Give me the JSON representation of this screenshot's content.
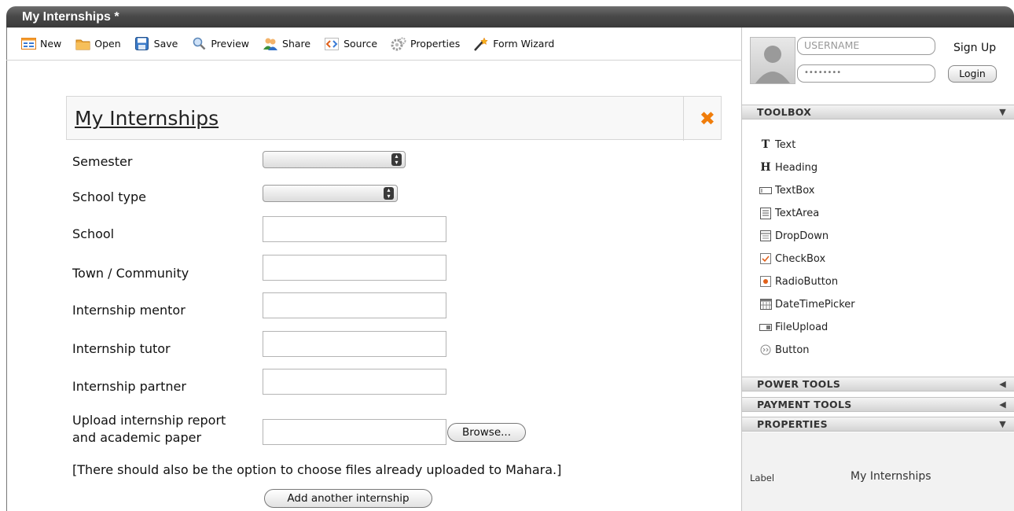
{
  "window": {
    "title": "My Internships *"
  },
  "toolbar": {
    "new": "New",
    "open": "Open",
    "save": "Save",
    "preview": "Preview",
    "share": "Share",
    "source": "Source",
    "properties": "Properties",
    "wizard": "Form Wizard"
  },
  "form": {
    "title": "My Internships",
    "fields": {
      "semester": "Semester",
      "school_type": "School type",
      "school": "School",
      "town": "Town / Community",
      "mentor": "Internship mentor",
      "tutor": "Internship tutor",
      "partner": "Internship partner",
      "upload_1": "Upload internship report",
      "upload_2": "and academic paper"
    },
    "browse": "Browse...",
    "note": "[There should also be the option to choose files already uploaded to Mahara.]",
    "add_button": "Add another internship"
  },
  "login": {
    "username_placeholder": "USERNAME",
    "password_mask": "••••••••",
    "signup": "Sign Up",
    "login": "Login"
  },
  "panels": {
    "toolbox": "TOOLBOX",
    "power": "POWER TOOLS",
    "payment": "PAYMENT TOOLS",
    "properties": "PROPERTIES"
  },
  "toolbox": {
    "items": [
      "Text",
      "Heading",
      "TextBox",
      "TextArea",
      "DropDown",
      "CheckBox",
      "RadioButton",
      "DateTimePicker",
      "FileUpload",
      "Button"
    ]
  },
  "properties": {
    "label_key": "Label",
    "label_value": "My Internships"
  },
  "colors": {
    "accent": "#f07d0b",
    "titlebar": "#4a4a4a"
  }
}
